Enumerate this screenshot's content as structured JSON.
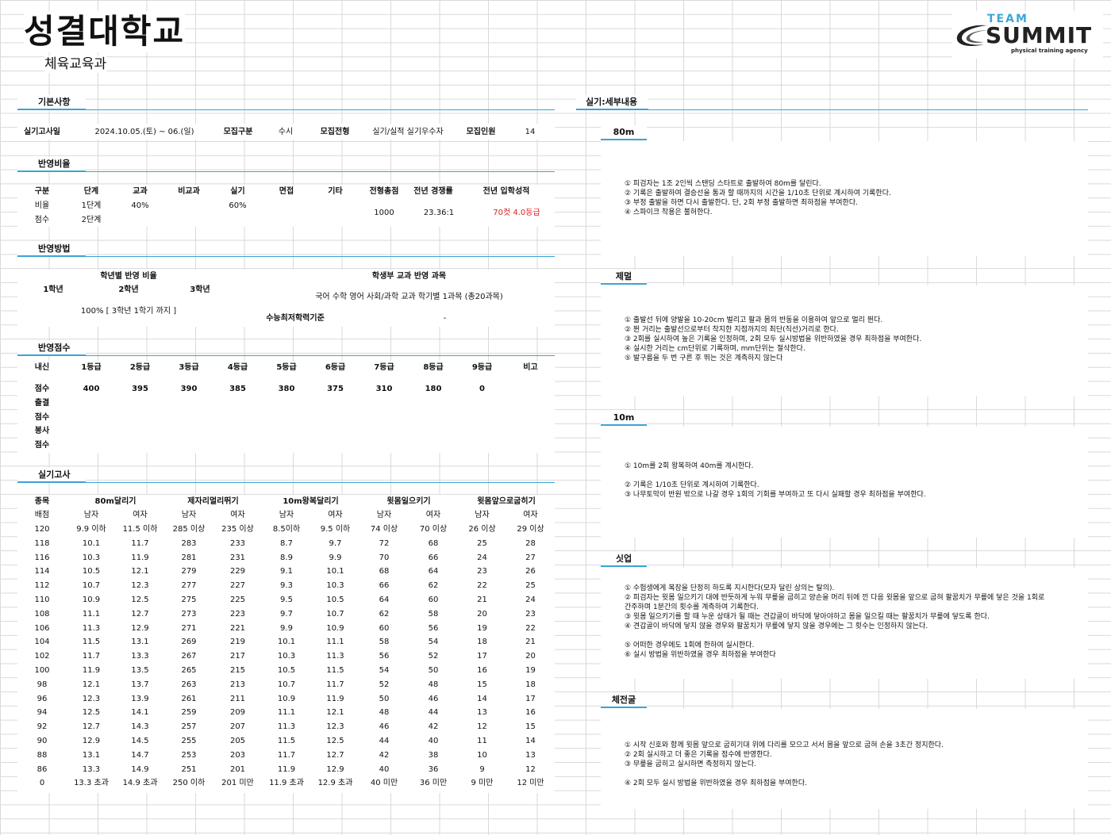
{
  "header": {
    "title": "성결대학교",
    "subtitle": "체육교육과",
    "logo_team": "TEAM",
    "logo_summit": "SUMMIT",
    "logo_tag": "physical training agency"
  },
  "basic": {
    "section": "기본사항",
    "exam_date_label": "실기고사일",
    "exam_date": "2024.10.05.(토) ~ 06.(일)",
    "type_label": "모집구분",
    "type": "수시",
    "track_label": "모집전형",
    "track": "실기/실적 실기우수자",
    "quota_label": "모집인원",
    "quota": "14"
  },
  "ratio": {
    "section": "반영비율",
    "headers": [
      "구분",
      "단계",
      "교과",
      "비교과",
      "실기",
      "면접",
      "기타",
      "전형총점",
      "전년 경쟁률",
      "전년 입학성적"
    ],
    "row1": [
      "비율",
      "1단계",
      "40%",
      "",
      "60%"
    ],
    "row2": [
      "점수",
      "2단계"
    ],
    "total": "1000",
    "competition": "23.36:1",
    "admission": "70컷 4.0등급"
  },
  "method": {
    "section": "반영방법",
    "grade_ratio_label": "학년별 반영 비율",
    "years": [
      "1학년",
      "2학년",
      "3학년"
    ],
    "grade_ratio": "100% [ 3학년 1학기 까지 ]",
    "subjects_label": "학생부 교과 반영 과목",
    "subjects": "국어 수학 영어 사회/과학 교과 학기별 1과목 (총20과목)",
    "csat_label": "수능최저학력기준",
    "csat": "-"
  },
  "scores": {
    "section": "반영점수",
    "headers": [
      "내신",
      "1등급",
      "2등급",
      "3등급",
      "4등급",
      "5등급",
      "6등급",
      "7등급",
      "8등급",
      "9등급",
      "비고"
    ],
    "score_label": "점수",
    "values": [
      "400",
      "395",
      "390",
      "385",
      "380",
      "375",
      "310",
      "180",
      "0"
    ],
    "attendance": "출결",
    "attendance_score": "점수",
    "volunteer": "봉사",
    "volunteer_score": "점수"
  },
  "practical": {
    "section": "실기고사",
    "event_label": "종목",
    "points_label": "배점",
    "events": [
      "80m달리기",
      "제자리멀리뛰기",
      "10m왕복달리기",
      "윗몸일으키기",
      "윗몸앞으로굽히기"
    ],
    "genders": [
      "남자",
      "여자"
    ],
    "rows": [
      [
        "120",
        "9.9 이하",
        "11.5 이하",
        "285 이상",
        "235 이상",
        "8.5이하",
        "9.5 이하",
        "74 이상",
        "70 이상",
        "26 이상",
        "29 이상"
      ],
      [
        "118",
        "10.1",
        "11.7",
        "283",
        "233",
        "8.7",
        "9.7",
        "72",
        "68",
        "25",
        "28"
      ],
      [
        "116",
        "10.3",
        "11.9",
        "281",
        "231",
        "8.9",
        "9.9",
        "70",
        "66",
        "24",
        "27"
      ],
      [
        "114",
        "10.5",
        "12.1",
        "279",
        "229",
        "9.1",
        "10.1",
        "68",
        "64",
        "23",
        "26"
      ],
      [
        "112",
        "10.7",
        "12.3",
        "277",
        "227",
        "9.3",
        "10.3",
        "66",
        "62",
        "22",
        "25"
      ],
      [
        "110",
        "10.9",
        "12.5",
        "275",
        "225",
        "9.5",
        "10.5",
        "64",
        "60",
        "21",
        "24"
      ],
      [
        "108",
        "11.1",
        "12.7",
        "273",
        "223",
        "9.7",
        "10.7",
        "62",
        "58",
        "20",
        "23"
      ],
      [
        "106",
        "11.3",
        "12.9",
        "271",
        "221",
        "9.9",
        "10.9",
        "60",
        "56",
        "19",
        "22"
      ],
      [
        "104",
        "11.5",
        "13.1",
        "269",
        "219",
        "10.1",
        "11.1",
        "58",
        "54",
        "18",
        "21"
      ],
      [
        "102",
        "11.7",
        "13.3",
        "267",
        "217",
        "10.3",
        "11.3",
        "56",
        "52",
        "17",
        "20"
      ],
      [
        "100",
        "11.9",
        "13.5",
        "265",
        "215",
        "10.5",
        "11.5",
        "54",
        "50",
        "16",
        "19"
      ],
      [
        "98",
        "12.1",
        "13.7",
        "263",
        "213",
        "10.7",
        "11.7",
        "52",
        "48",
        "15",
        "18"
      ],
      [
        "96",
        "12.3",
        "13.9",
        "261",
        "211",
        "10.9",
        "11.9",
        "50",
        "46",
        "14",
        "17"
      ],
      [
        "94",
        "12.5",
        "14.1",
        "259",
        "209",
        "11.1",
        "12.1",
        "48",
        "44",
        "13",
        "16"
      ],
      [
        "92",
        "12.7",
        "14.3",
        "257",
        "207",
        "11.3",
        "12.3",
        "46",
        "42",
        "12",
        "15"
      ],
      [
        "90",
        "12.9",
        "14.5",
        "255",
        "205",
        "11.5",
        "12.5",
        "44",
        "40",
        "11",
        "14"
      ],
      [
        "88",
        "13.1",
        "14.7",
        "253",
        "203",
        "11.7",
        "12.7",
        "42",
        "38",
        "10",
        "13"
      ],
      [
        "86",
        "13.3",
        "14.9",
        "251",
        "201",
        "11.9",
        "12.9",
        "40",
        "36",
        "9",
        "12"
      ],
      [
        "0",
        "13.3 초과",
        "14.9 초과",
        "250 이하",
        "201 미만",
        "11.9 초과",
        "12.9 초과",
        "40 미만",
        "36 미만",
        "9 미만",
        "12 미만"
      ]
    ]
  },
  "details": {
    "section": "실기:세부내용",
    "items": [
      {
        "title": "80m",
        "lines": [
          "① 피검자는 1조 2인씩 스탠딩 스타트로 출발하여 80m를 달린다.",
          "② 기록은 출발하여 결승선을 통과 할 때까지의 시간을 1/10초 단위로 계시하여 기록한다.",
          "③ 부정 출발을 하면 다시 출발한다. 단, 2회 부정 출발하면 최하점을 부여한다.",
          "④ 스파이크 착용은 불허한다."
        ]
      },
      {
        "title": "제멀",
        "lines": [
          "① 출발선 뒤에 양발을 10-20cm 벌리고 팔과 몸의 반동을 이용하여 앞으로 멀리 뛴다.",
          "② 뛴 거리는 출발선으로부터 착지한 지점까지의 최단(직선)거리로 한다.",
          "③ 2회를 실시하여 높은 기록을 인정하며, 2회 모두 실시방법을 위반하였을 경우 최하점을 부여한다.",
          "④ 실시한 거리는 cm단위로 기록하며, mm단위는 절삭한다.",
          "⑤ 발구름을 두 번 구른 후 뛰는 것은 계측하지 않는다"
        ]
      },
      {
        "title": "10m",
        "lines": [
          "① 10m를 2회 왕복하여 40m를 계시한다.",
          "",
          "② 기록은 1/10초 단위로 계시하여 기록한다.",
          "③ 나무토막이 반원 밖으로 나갈 경우 1회의 기회를 부여하고 또 다시 실패할 경우 최하점을 부여한다."
        ]
      },
      {
        "title": "싯업",
        "lines": [
          "① 수험생에게 복장을 단정히 하도록 지시한다(모자 달린 상의는 탈의).",
          "② 피검자는 윗몸 일으키기 대에 반듯하게 누워 무릎을 굽히고 양손을 머리 뒤에 낀 다음 윗몸을 앞으로  굽혀 팔꿈치가 무릎에 닿은 것을 1회로",
          "    간주하며 1분간의 횟수를 계측하여 기록한다.",
          "③ 윗몸 일으키기를 할 때 누운 상태가 될 때는 견갑골이 바닥에 닿아야하고 몸을 일으킬 때는 팔꿈치가  무릎에 닿도록 한다.",
          "④ 견갑골이 바닥에 닿지 않을 경우와 팔꿈치가 무릎에 닿지 않을 경우에는 그 횟수는 인정하지 않는다.",
          "",
          "⑤ 어떠한 경우에도 1회에 한하여 실시한다.",
          "⑥ 실시 방법을 위반하였을 경우 최하점을 부여한다"
        ]
      },
      {
        "title": "체전굴",
        "lines": [
          "① 시작 신호와 함께 윗몸 앞으로 굽히기대 위에 다리를 모으고 서서 몸을 앞으로 굽혀 손을 3초간 정지한다.",
          "② 2회 실시하고 더 좋은 기록을 점수에 반영한다.",
          "③ 무릎을 굽히고 실시하면 측정하지 않는다.",
          "",
          "④ 2회 모두 실시 방법을 위반하였을 경우 최하점을 부여한다."
        ]
      }
    ]
  }
}
